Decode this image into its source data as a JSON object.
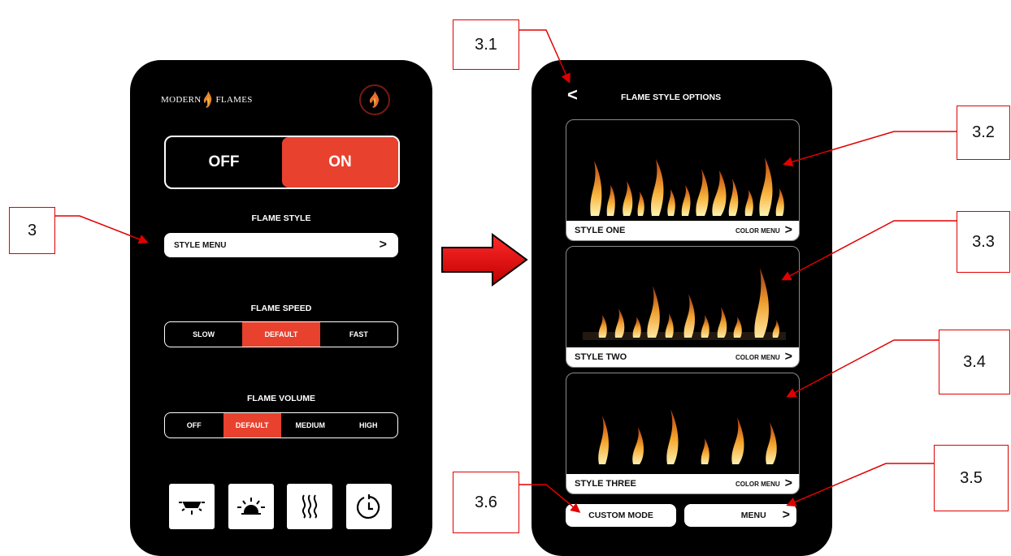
{
  "left_phone": {
    "brand": {
      "left": "MODERN",
      "right": "FLAMES"
    },
    "power": {
      "off_label": "OFF",
      "on_label": "ON"
    },
    "flame_style": {
      "heading": "FLAME STYLE",
      "button_label": "STYLE MENU",
      "chevron": ">"
    },
    "flame_speed": {
      "heading": "FLAME SPEED",
      "options": [
        "SLOW",
        "DEFAULT",
        "FAST"
      ],
      "selected": "DEFAULT"
    },
    "flame_volume": {
      "heading": "FLAME VOLUME",
      "options": [
        "OFF",
        "DEFAULT",
        "MEDIUM",
        "HIGH"
      ],
      "selected": "DEFAULT"
    },
    "bottom_icons": [
      "light-off-icon",
      "light-on-icon",
      "heat-icon",
      "timer-icon"
    ]
  },
  "right_phone": {
    "back_glyph": "<",
    "title": "FLAME STYLE OPTIONS",
    "styles": [
      {
        "name": "STYLE ONE",
        "color_menu": "COLOR MENU",
        "chevron": ">"
      },
      {
        "name": "STYLE TWO",
        "color_menu": "COLOR MENU",
        "chevron": ">"
      },
      {
        "name": "STYLE THREE",
        "color_menu": "COLOR MENU",
        "chevron": ">"
      }
    ],
    "custom_mode_label": "CUSTOM MODE",
    "menu_label": "MENU",
    "menu_chevron": ">"
  },
  "callouts": {
    "c3": "3",
    "c31": "3.1",
    "c32": "3.2",
    "c33": "3.3",
    "c34": "3.4",
    "c35": "3.5",
    "c36": "3.6"
  },
  "colors": {
    "accent": "#e8412e",
    "callout": "#e00000",
    "arrow": "#e00000"
  }
}
